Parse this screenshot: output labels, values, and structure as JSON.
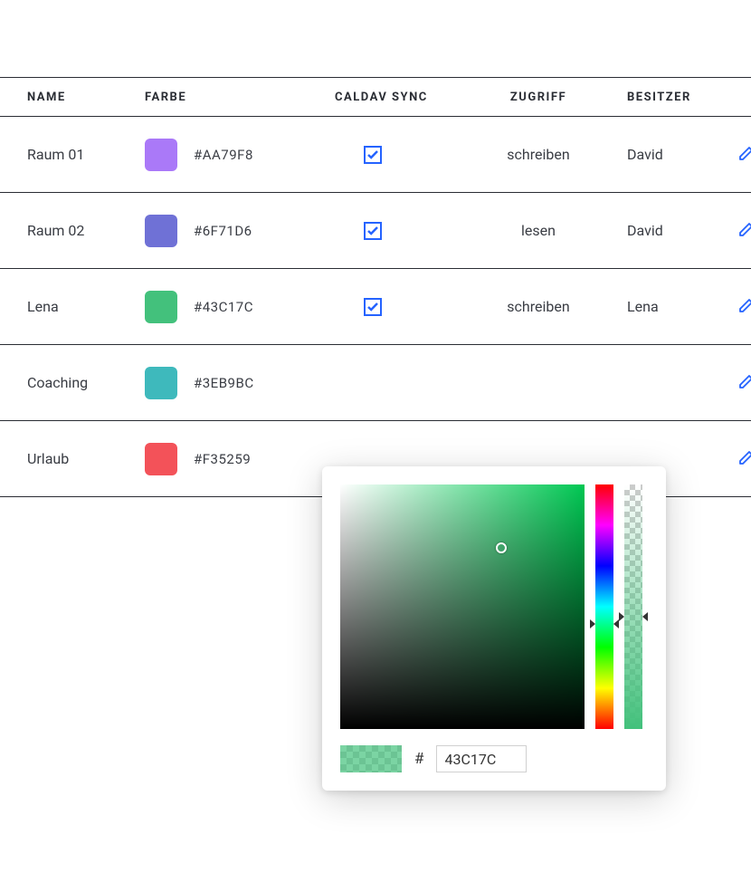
{
  "headers": {
    "name": "NAME",
    "color": "FARBE",
    "sync": "CALDAV SYNC",
    "access": "ZUGRIFF",
    "owner": "BESITZER"
  },
  "rows": [
    {
      "name": "Raum 01",
      "swatch": "#AA79F8",
      "hex": "#AA79F8",
      "sync": true,
      "access": "schreiben",
      "owner": "David"
    },
    {
      "name": "Raum 02",
      "swatch": "#6F71D6",
      "hex": "#6F71D6",
      "sync": true,
      "access": "lesen",
      "owner": "David"
    },
    {
      "name": "Lena",
      "swatch": "#43C17C",
      "hex": "#43C17C",
      "sync": true,
      "access": "schreiben",
      "owner": "Lena"
    },
    {
      "name": "Coaching",
      "swatch": "#3EB9BC",
      "hex": "#3EB9BC",
      "sync": null,
      "access": "",
      "owner": ""
    },
    {
      "name": "Urlaub",
      "swatch": "#F35259",
      "hex": "#F35259",
      "sync": null,
      "access": "",
      "owner": ""
    }
  ],
  "picker": {
    "hash": "#",
    "hex_value": "43C17C",
    "current_color": "#43C17C"
  },
  "colors": {
    "accent": "#2563ff",
    "text": "#2a2d34"
  }
}
